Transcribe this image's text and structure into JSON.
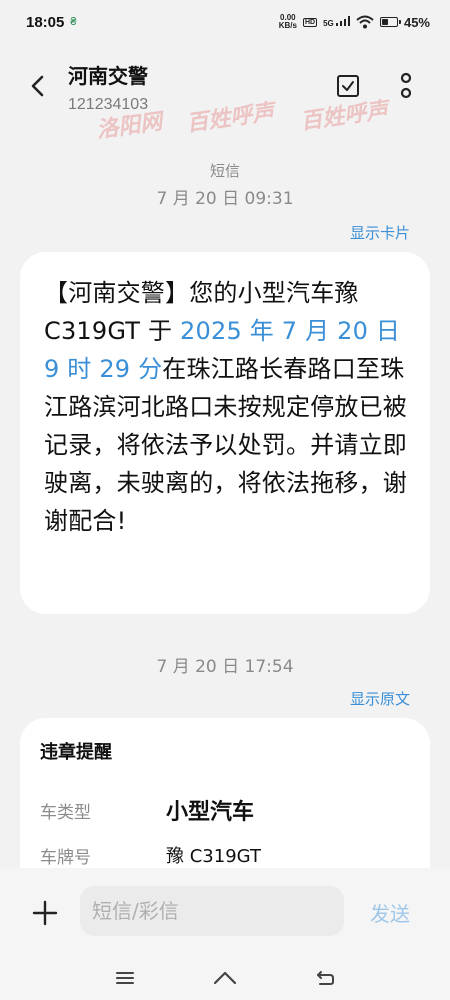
{
  "status_bar": {
    "time": "18:05",
    "notification_icon": "currency-notification-icon",
    "net_speed_value": "0.00",
    "net_speed_unit": "KB/s",
    "hd_label": "HD",
    "network_label": "5G",
    "battery_level": 0.45,
    "battery_percent": "45%"
  },
  "header": {
    "contact_name": "河南交警",
    "contact_number": "121234103"
  },
  "watermarks": [
    "洛阳网",
    "百姓呼声",
    "百姓呼声",
    "洛阳网",
    "百姓呼声",
    "洛阳网",
    "百姓呼声"
  ],
  "thread": {
    "channel_label": "短信",
    "first_timestamp": "7 月 20 日 09:31",
    "show_card_link": "显示卡片",
    "message": {
      "part1": "【河南交警】您的小型汽车豫C319GT 于 ",
      "date_link": "2025 年 7 月 20 日 9 时 29 分",
      "part2": "在珠江路长春路口至珠江路滨河北路口未按规定停放已被记录，将依法予以处罚。并请立即驶离，未驶离的，将依法拖移，谢谢配合!"
    },
    "second_timestamp": "7 月 20 日 17:54",
    "show_original_link": "显示原文",
    "card": {
      "title": "违章提醒",
      "rows": [
        {
          "label": "车类型",
          "value": "小型汽车"
        },
        {
          "label": "车牌号",
          "value": "豫 C319GT"
        }
      ]
    }
  },
  "composer": {
    "placeholder": "短信/彩信",
    "send_label": "发送"
  },
  "colors": {
    "link": "#3a8fd6",
    "background": "#f2f2f2",
    "bubble": "#ffffff",
    "watermark": "#e67878"
  }
}
